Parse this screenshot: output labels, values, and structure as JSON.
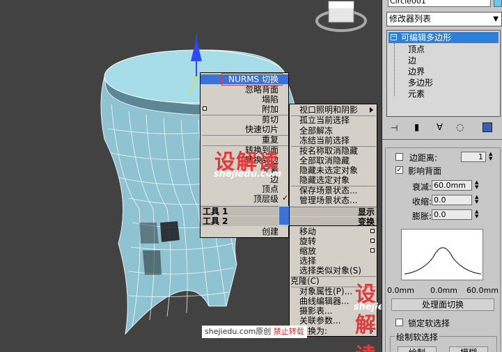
{
  "object_name": "Circle001",
  "modifier_list": "修改器列表",
  "stack": {
    "root": "可编辑多边形",
    "items": [
      "顶点",
      "边",
      "边界",
      "多边形",
      "元素"
    ]
  },
  "left_menu": {
    "top": [
      "NURMS 切换",
      "忽略背面",
      "塌陷",
      "附加",
      "剪切",
      "快速切片",
      "重复",
      "转换到面",
      "转换到边",
      "元素",
      "边",
      "顶点",
      "顶层级"
    ],
    "tools1": "工具 1",
    "tools2": "工具 2",
    "create": "创建"
  },
  "right_menu": {
    "display_label": "显示",
    "transform_label": "变换",
    "display": [
      "视口照明和阴影",
      "孤立当前选择",
      "全部解冻",
      "冻结当前选择",
      "按名称取消隐藏",
      "全部取消隐藏",
      "隐藏未选定对象",
      "隐藏选定对象",
      "保存场景状态...",
      "管理场景状态..."
    ],
    "transform": [
      "移动",
      "旋转",
      "缩放",
      "选择",
      "选择类似对象(S)",
      "克隆(C)",
      "对象属性(P)...",
      "曲线编辑器...",
      "摄影表...",
      "关联参数...",
      "转换为:"
    ]
  },
  "soft_selection": {
    "edge_distance": "边距离:",
    "edge_distance_value": "1",
    "affect_backfacing": "影响背面",
    "falloff": "衰减:",
    "falloff_value": "60.0mm",
    "pinch": "收缩:",
    "pinch_value": "0.0",
    "bubble": "膨胀:",
    "bubble_value": "0.0",
    "graph_left": "0.0mm",
    "graph_mid": "0.0mm",
    "graph_right": "60.0mm",
    "shaded_face_toggle": "处理面切换",
    "lock_soft": "锁定软选择",
    "paint_group": "绘制软选择",
    "paint_btn": "绘制",
    "blur_btn": "模糊"
  },
  "watermarks": {
    "logo": "设解读",
    "site": "shejiedu.com",
    "footer_site": "shejiedu.com原创",
    "footer_warn": "禁止转载"
  },
  "colors": {
    "menu_bg": "#d4d0c8",
    "highlight": "#3b72d8",
    "stack_highlight": "#2f7fd8"
  }
}
